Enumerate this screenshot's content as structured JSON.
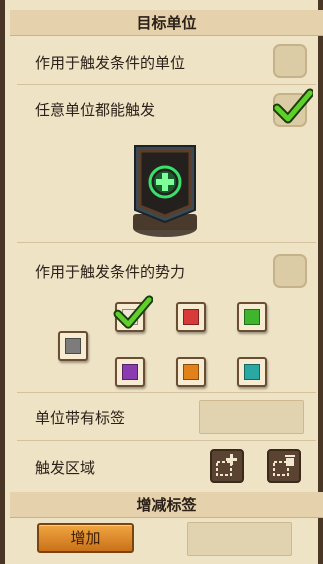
{
  "sections": {
    "target_unit_title": "目标单位",
    "tags_title": "增减标签"
  },
  "rows": {
    "apply_to_trigger_unit": "作用于触发条件的单位",
    "any_unit_trigger": "任意单位都能触发",
    "apply_to_trigger_force": "作用于触发条件的势力",
    "unit_has_tag": "单位带有标签",
    "trigger_area": "触发区域"
  },
  "checkbox_states": {
    "apply_to_trigger_unit": false,
    "any_unit_trigger": true,
    "apply_to_trigger_force": false
  },
  "forces": [
    {
      "name": "white",
      "color": "#efe6d6",
      "checked": true
    },
    {
      "name": "red",
      "color": "#d83a3a",
      "checked": false
    },
    {
      "name": "green",
      "color": "#3fb52d",
      "checked": false
    },
    {
      "name": "gray",
      "color": "#7c7c7c",
      "checked": false
    },
    {
      "name": "purple",
      "color": "#8a3bb0",
      "checked": false
    },
    {
      "name": "orange",
      "color": "#e2801a",
      "checked": false
    },
    {
      "name": "teal",
      "color": "#2aa8a3",
      "checked": false
    }
  ],
  "buttons": {
    "add_label": "增加"
  },
  "icons": {
    "unit_card": "unit-card-plus-icon",
    "area_add": "area-add-icon",
    "area_delete": "area-delete-icon"
  }
}
